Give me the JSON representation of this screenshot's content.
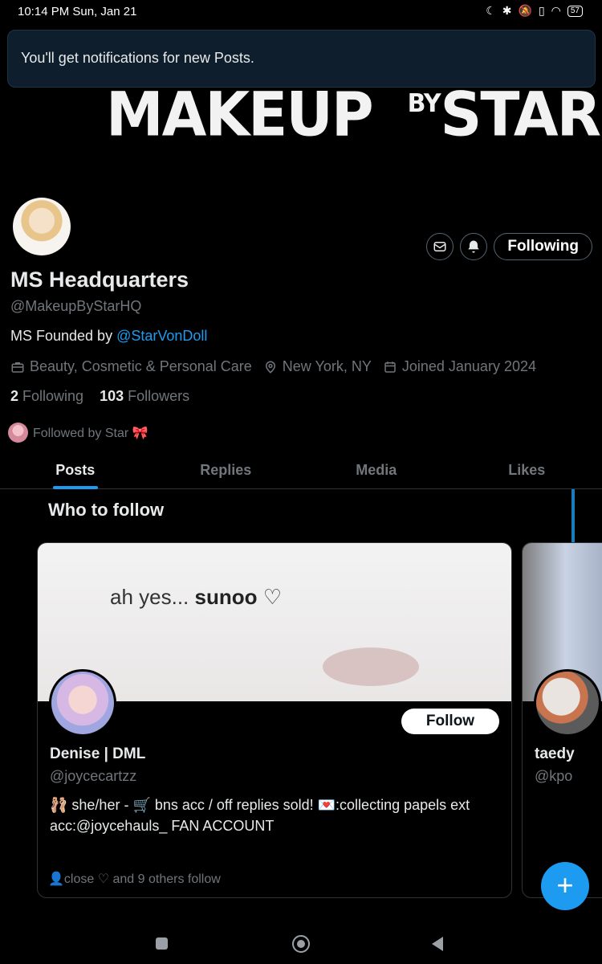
{
  "status_bar": {
    "time": "10:14 PM Sun, Jan 21",
    "battery": "57"
  },
  "toast": {
    "message": "You'll get notifications for new Posts."
  },
  "banner": {
    "logo_main": "MAKEUP",
    "logo_by": "BY",
    "logo_star": "STAR"
  },
  "profile": {
    "display_name": "MS Headquarters",
    "handle": "@MakeupByStarHQ",
    "bio_prefix": "MS Founded by ",
    "bio_mention": "@StarVonDoll",
    "category": "Beauty, Cosmetic & Personal Care",
    "location": "New York, NY",
    "joined": "Joined January 2024",
    "following_count": "2",
    "following_label": "Following",
    "followers_count": "103",
    "followers_label": "Followers",
    "followed_by": "Followed by Star 🎀",
    "following_button": "Following"
  },
  "tabs": [
    {
      "label": "Posts",
      "active": true
    },
    {
      "label": "Replies",
      "active": false
    },
    {
      "label": "Media",
      "active": false
    },
    {
      "label": "Likes",
      "active": false
    }
  ],
  "who_to_follow": {
    "title": "Who to follow",
    "cards": [
      {
        "banner_text_prefix": "ah yes... ",
        "banner_text_bold": "sunoo",
        "banner_text_suffix": " ♡",
        "name": "Denise | DML",
        "handle": "@joycecartzz",
        "bio": "🩰 she/her - 🛒 bns acc / off replies sold! 💌:collecting papels ext acc:@joycehauls_ FAN ACCOUNT",
        "follow_button": "Follow",
        "footer": "close ♡ and 9 others follow"
      },
      {
        "name": "taedy",
        "handle": "@kpo"
      }
    ]
  },
  "fab": {
    "label": "+"
  },
  "colors": {
    "accent": "#1d9bf0",
    "background": "#000000",
    "secondary_text": "#71767b"
  }
}
